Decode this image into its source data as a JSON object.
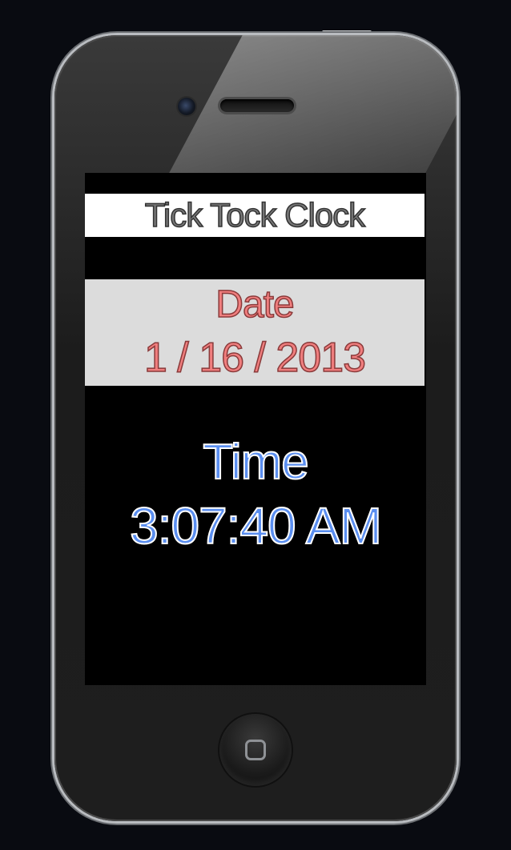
{
  "app": {
    "title": "Tick Tock Clock"
  },
  "date": {
    "label": "Date",
    "value": "1 / 16 / 2013"
  },
  "time": {
    "label": "Time",
    "value": "3:07:40 AM"
  },
  "colors": {
    "date_text": "#f07e7e",
    "time_text": "#5a8ef0",
    "title_bar_bg": "#ffffff",
    "date_panel_bg": "#dcdcdc",
    "screen_bg": "#000000"
  },
  "icons": {
    "front_camera": "camera-icon",
    "earpiece": "speaker-icon",
    "home_button": "home-button-icon"
  }
}
